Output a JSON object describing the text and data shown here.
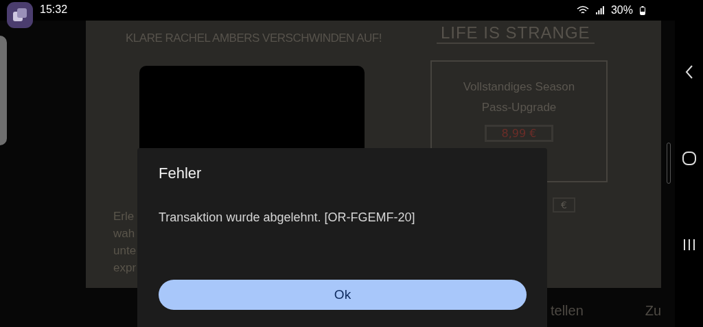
{
  "status_bar": {
    "time": "15:32",
    "battery": "30%"
  },
  "game": {
    "headline": "KLARE RACHEL AMBERS VERSCHWINDEN AUF!",
    "logo": "LIFE IS STRANGE",
    "offer": {
      "title": "Vollstandiges Season Pass-Upgrade",
      "price": "8,99 €",
      "second_price": "€"
    },
    "description_lines": [
      "Erle",
      "wah",
      "unte",
      "expr"
    ],
    "bottom_labels": [
      "tellen",
      "Zu"
    ]
  },
  "dialog": {
    "title": "Fehler",
    "message": "Transaktion wurde abgelehnt. [OR-FGEMF-20]",
    "button": "Ok"
  }
}
